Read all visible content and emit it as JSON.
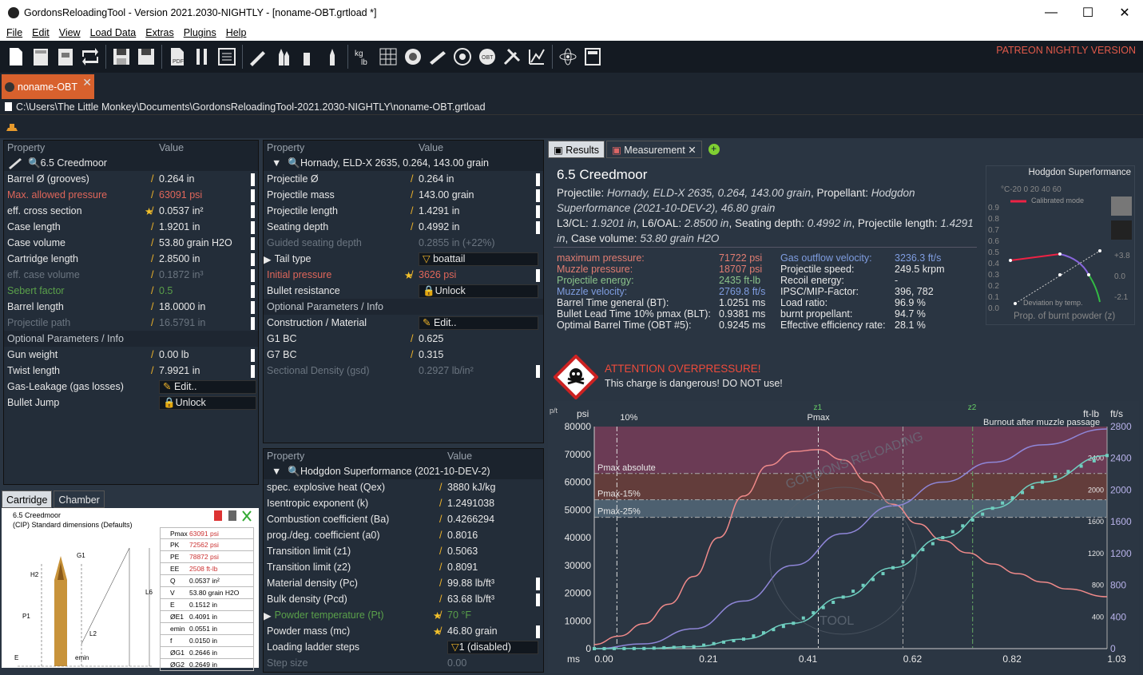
{
  "window": {
    "title": "GordonsReloadingTool - Version 2021.2030-NIGHTLY - [noname-OBT.grtload *]",
    "min": "—",
    "max": "☐",
    "close": "✕"
  },
  "menu": [
    "File",
    "Edit",
    "View",
    "Load Data",
    "Extras",
    "Plugins",
    "Help"
  ],
  "patreon": "PATREON NIGHTLY VERSION",
  "doc_tab": "noname-OBT",
  "path": "C:\\Users\\The Little Monkey\\Documents\\GordonsReloadingTool-2021.2030-NIGHTLY\\noname-OBT.grtload",
  "cartridge_panel": {
    "h_prop": "Property",
    "h_val": "Value",
    "selected": "6.5 Creedmoor",
    "rows": [
      [
        "Barrel Ø (grooves)",
        "0.264 in"
      ],
      [
        "Max. allowed pressure",
        "63091 psi"
      ],
      [
        "eff. cross section",
        "0.0537 in²"
      ],
      [
        "Case length",
        "1.9201 in"
      ],
      [
        "Case volume",
        "53.80 grain H2O"
      ],
      [
        "Cartridge length",
        "2.8500 in"
      ],
      [
        "eff. case volume",
        "0.1872 in³"
      ],
      [
        "Sebert factor",
        "0.5"
      ],
      [
        "Barrel length",
        "18.0000 in"
      ],
      [
        "Projectile path",
        "16.5791 in"
      ]
    ],
    "group": "Optional Parameters / Info",
    "opt": [
      [
        "Gun weight",
        "0.00 lb"
      ],
      [
        "Twist length",
        "7.9921 in"
      ],
      [
        "Gas-Leakage (gas losses)",
        "Edit.."
      ],
      [
        "Bullet Jump",
        "Unlock"
      ]
    ]
  },
  "projectile_panel": {
    "h_prop": "Property",
    "h_val": "Value",
    "selected": "Hornady, ELD-X 2635, 0.264, 143.00 grain",
    "rows": [
      [
        "Projectile Ø",
        "0.264 in"
      ],
      [
        "Projectile mass",
        "143.00 grain"
      ],
      [
        "Projectile length",
        "1.4291 in"
      ],
      [
        "Seating depth",
        "0.4992 in"
      ],
      [
        "Guided seating depth",
        "0.2855 in (+22%)"
      ],
      [
        "Tail type",
        "boattail"
      ],
      [
        "Initial pressure",
        "3626 psi"
      ],
      [
        "Bullet resistance",
        "Unlock"
      ]
    ],
    "group": "Optional Parameters / Info",
    "opt": [
      [
        "Construction / Material",
        "Edit.."
      ],
      [
        "G1 BC",
        "0.625"
      ],
      [
        "G7 BC",
        "0.315"
      ],
      [
        "Sectional Density (gsd)",
        "0.2927 lb/in²"
      ]
    ]
  },
  "powder_panel": {
    "h_prop": "Property",
    "h_val": "Value",
    "selected": "Hodgdon Superformance (2021-10-DEV-2)",
    "rows": [
      [
        "spec. explosive heat (Qex)",
        "3880 kJ/kg"
      ],
      [
        "Isentropic exponent (k)",
        "1.2491038"
      ],
      [
        "Combustion coefficient (Ba)",
        "0.4266294"
      ],
      [
        "prog./deg. coefficient (a0)",
        "0.8016"
      ],
      [
        "Transition limit (z1)",
        "0.5063"
      ],
      [
        "Transition limit (z2)",
        "0.8091"
      ],
      [
        "Material density (Pc)",
        "99.88 lb/ft³"
      ],
      [
        "Bulk density (Pcd)",
        "63.68 lb/ft³"
      ],
      [
        "Powder temperature (Pt)",
        "70 °F"
      ],
      [
        "Powder mass (mc)",
        "46.80 grain"
      ],
      [
        "Loading ladder steps",
        "1 (disabled)"
      ],
      [
        "Step size",
        "0.00"
      ]
    ]
  },
  "result_tabs": [
    "Results",
    "Measurement"
  ],
  "results": {
    "title": "6.5 Creedmoor",
    "line1a": "Projectile: ",
    "line1b": "Hornady, ELD-X 2635, 0.264, 143.00 grain",
    "line1c": ", Propellant: ",
    "line1d": "Hodgdon",
    "line2": "Superformance (2021-10-DEV-2), 46.80 grain",
    "line3a": "L3/CL: ",
    "line3b": "1.9201 in",
    "line3c": ", L6/OAL: ",
    "line3d": "2.8500 in",
    "line3e": ", Seating depth: ",
    "line3f": "0.4992 in",
    "line3g": ", Projectile length: ",
    "line3h": "1.4291",
    "line4a": "in",
    "line4b": ", Case volume: ",
    "line4c": "53.80 grain H2O",
    "left": [
      [
        "maximum pressure:",
        "71722 psi"
      ],
      [
        "Muzzle pressure:",
        "18707 psi"
      ],
      [
        "Projectile energy:",
        "2435 ft-lb"
      ],
      [
        "Muzzle velocity:",
        "2769.8 ft/s"
      ],
      [
        "Barrel Time general (BT):",
        "1.0251 ms"
      ],
      [
        "Bullet Lead Time 10% pmax (BLT):",
        "0.9381 ms"
      ],
      [
        "Optimal Barrel Time (OBT #5):",
        "0.9245 ms"
      ]
    ],
    "right": [
      [
        "Gas outflow velocity:",
        "3236.3 ft/s"
      ],
      [
        "Projectile speed:",
        "249.5 krpm"
      ],
      [
        "Recoil energy:",
        "-"
      ],
      [
        "IPSC/MIP-Factor:",
        "396, 782"
      ],
      [
        "Load ratio:",
        "96.9 %"
      ],
      [
        "burnt propellant:",
        "94.7 %"
      ],
      [
        "Effective efficiency rate:",
        "28.1 %"
      ]
    ]
  },
  "warning": {
    "title": "ATTENTION OVERPRESSURE!",
    "text": "This charge is dangerous! DO NOT use!"
  },
  "hodgdon_box": {
    "title": "Hodgdon Superformance",
    "temps": "°C-20  0  20  40  60",
    "cal": "Calibrated mode",
    "dev": "Deviation by temp.",
    "bottom": "Prop. of burnt powder (z)",
    "yticks": [
      "0.9",
      "0.8",
      "0.7",
      "0.6",
      "0.5",
      "0.4",
      "0.3",
      "0.2",
      "0.1",
      "0.0"
    ],
    "rticks": [
      "+3.8",
      "0.0",
      "-2.1"
    ]
  },
  "bottom_tabs": [
    "Cartridge",
    "Chamber"
  ],
  "cart_box": {
    "name": "6.5 Creedmoor",
    "std": "(CIP) Standard dimensions (Defaults)",
    "table": [
      [
        "Pmax",
        "63091 psi"
      ],
      [
        "PK",
        "72562 psi"
      ],
      [
        "PE",
        "78872 psi"
      ],
      [
        "EE",
        "2508 ft-lb"
      ],
      [
        "Q",
        "0.0537 in²"
      ],
      [
        "V",
        "53.80 grain H2O"
      ],
      [
        "E",
        "0.1512 in"
      ],
      [
        "ØE1",
        "0.4091 in"
      ],
      [
        "emin",
        "0.0551 in"
      ],
      [
        "f",
        "0.0150 in"
      ],
      [
        "ØG1",
        "0.2646 in"
      ],
      [
        "ØG2",
        "0.2649 in"
      ]
    ]
  },
  "chart_data": {
    "type": "line",
    "x_unit": "ms",
    "xticks": [
      "0.00",
      "0.21",
      "0.41",
      "0.62",
      "0.82",
      "1.03"
    ],
    "y_left_unit": "psi",
    "y_left_ticks": [
      "0",
      "10000",
      "20000",
      "30000",
      "40000",
      "50000",
      "60000",
      "70000",
      "80000"
    ],
    "y_right_unit_a": "ft-lb",
    "y_right_unit_b": "ft/s",
    "y_right_ticks": [
      "0",
      "400",
      "800",
      "1200",
      "1600",
      "2000",
      "2400",
      "2800"
    ],
    "annotations": {
      "p10": "10%",
      "z1": "z1",
      "pmax": "Pmax",
      "z2": "z2",
      "burnout": "Burnout after muzzle passage",
      "pabs": "Pmax absolute",
      "p15": "Pmax-15%",
      "p25": "Pmax-25%"
    },
    "series": [
      {
        "name": "pressure",
        "color": "#f08a8a",
        "x": [
          0,
          0.05,
          0.1,
          0.15,
          0.2,
          0.25,
          0.3,
          0.35,
          0.4,
          0.45,
          0.5,
          0.55,
          0.6,
          0.65,
          0.7,
          0.75,
          0.8,
          0.85,
          0.9,
          0.95,
          1.03
        ],
        "y": [
          1500,
          4500,
          9000,
          16000,
          26000,
          40000,
          55000,
          66000,
          71000,
          71700,
          68000,
          60000,
          52000,
          45000,
          39000,
          34500,
          30500,
          27000,
          24000,
          21500,
          18707
        ]
      },
      {
        "name": "velocity",
        "color": "#8f86d8",
        "x": [
          0,
          0.1,
          0.2,
          0.3,
          0.4,
          0.5,
          0.6,
          0.7,
          0.8,
          0.9,
          1.03
        ],
        "y": [
          0,
          60,
          250,
          600,
          1050,
          1450,
          1800,
          2100,
          2350,
          2570,
          2770
        ]
      },
      {
        "name": "energy",
        "color": "#6fcfc0",
        "x": [
          0,
          0.1,
          0.2,
          0.3,
          0.4,
          0.5,
          0.6,
          0.7,
          0.8,
          0.9,
          1.03
        ],
        "y": [
          0,
          2,
          25,
          120,
          320,
          650,
          1020,
          1400,
          1770,
          2100,
          2435
        ]
      }
    ]
  }
}
